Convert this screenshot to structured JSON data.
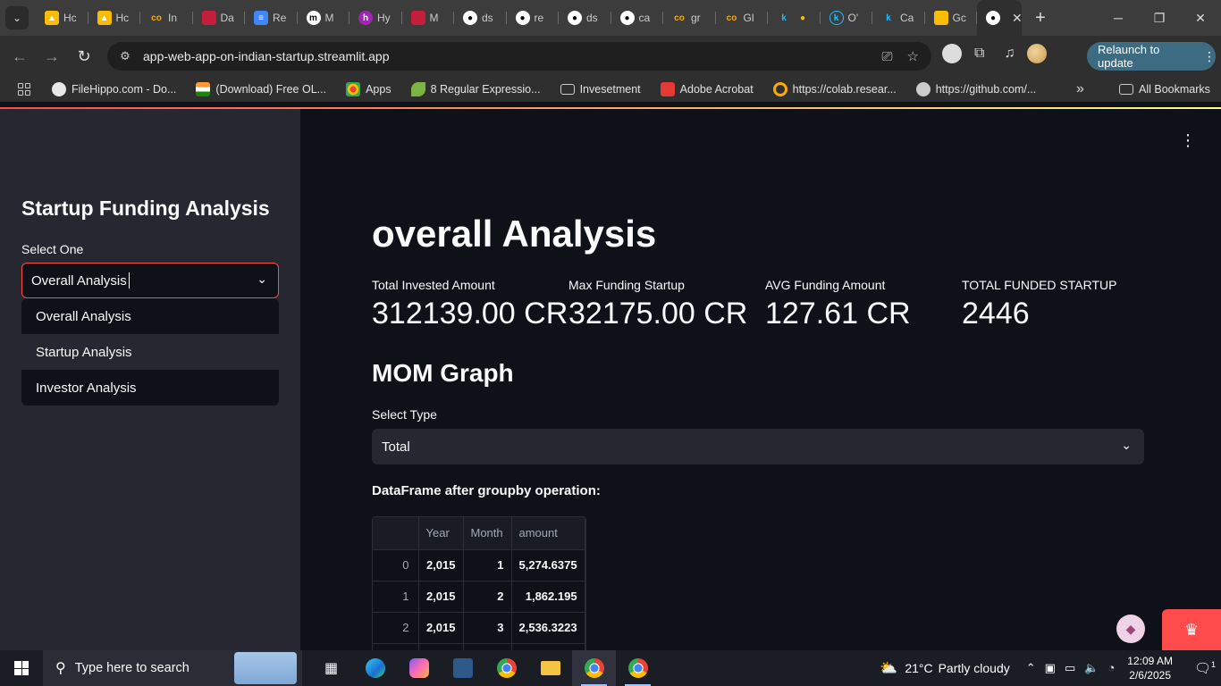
{
  "browser": {
    "tabs": [
      {
        "label": "Hc",
        "icon": "google-drive-icon",
        "color": "#fbbc04"
      },
      {
        "label": "Hc",
        "icon": "google-drive-icon",
        "color": "#fbbc04"
      },
      {
        "label": "In",
        "icon": "colab-icon",
        "color": "#f9ab00"
      },
      {
        "label": "Da",
        "icon": "app-icon",
        "color": "#c41e3a"
      },
      {
        "label": "Re",
        "icon": "docs-icon",
        "color": "#4285f4"
      },
      {
        "label": "M",
        "icon": "medium-icon",
        "color": "#ffffff"
      },
      {
        "label": "Hy",
        "icon": "hashnode-icon",
        "color": "#9c27b0"
      },
      {
        "label": "M",
        "icon": "app-icon",
        "color": "#c41e3a"
      },
      {
        "label": "ds",
        "icon": "github-icon",
        "color": "#ffffff"
      },
      {
        "label": "re",
        "icon": "github-icon",
        "color": "#ffffff"
      },
      {
        "label": "ds",
        "icon": "github-icon",
        "color": "#ffffff"
      },
      {
        "label": "ca",
        "icon": "github-icon",
        "color": "#ffffff"
      },
      {
        "label": "gr",
        "icon": "colab-icon",
        "color": "#f9ab00"
      },
      {
        "label": "Gl",
        "icon": "colab-icon",
        "color": "#f9ab00"
      },
      {
        "label": "",
        "icon": "kaggle-icon",
        "color": "#20beff"
      },
      {
        "label": "O'",
        "icon": "kaggle-circle-icon",
        "color": "#20beff"
      },
      {
        "label": "Ca",
        "icon": "kaggle-icon",
        "color": "#20beff"
      },
      {
        "label": "Gc",
        "icon": "keep-icon",
        "color": "#fbbc04"
      }
    ],
    "url": "app-web-app-on-indian-startup.streamlit.app",
    "relaunch_label": "Relaunch to update",
    "bookmarks": [
      {
        "label": "FileHippo.com - Do...",
        "color": "#e8e8e8"
      },
      {
        "label": "(Download) Free OL...",
        "color": "#ff9933"
      },
      {
        "label": "Apps",
        "color": "#ea4335"
      },
      {
        "label": "8 Regular Expressio...",
        "color": "#7cb342"
      },
      {
        "label": "Invesetment",
        "color": "#cccccc"
      },
      {
        "label": "Adobe Acrobat",
        "color": "#e53935"
      },
      {
        "label": "https://colab.resear...",
        "color": "#f9ab00"
      },
      {
        "label": "https://github.com/...",
        "color": "#cccccc"
      }
    ],
    "all_bookmarks_label": "All Bookmarks"
  },
  "sidebar": {
    "title": "Startup Funding Analysis",
    "select_label": "Select One",
    "selected_value": "Overall Analysis",
    "options": [
      "Overall Analysis",
      "Startup Analysis",
      "Investor Analysis"
    ]
  },
  "main": {
    "title": "overall Analysis",
    "metrics": [
      {
        "label": "Total Invested Amount",
        "value": "312139.00 CR"
      },
      {
        "label": "Max Funding Startup",
        "value": "32175.00 CR"
      },
      {
        "label": "AVG Funding Amount",
        "value": "127.61 CR"
      },
      {
        "label": "TOTAL FUNDED STARTUP",
        "value": "2446"
      }
    ],
    "subheader": "MOM Graph",
    "type_label": "Select Type",
    "type_value": "Total",
    "df_caption": "DataFrame after groupby operation:",
    "table": {
      "columns": [
        "",
        "Year",
        "Month",
        "amount"
      ],
      "rows": [
        [
          "0",
          "2,015",
          "1",
          "5,274.6375"
        ],
        [
          "1",
          "2,015",
          "2",
          "1,862.195"
        ],
        [
          "2",
          "2,015",
          "3",
          "2,536.3223"
        ]
      ]
    }
  },
  "taskbar": {
    "search_placeholder": "Type here to search",
    "weather_temp": "21°C",
    "weather_desc": "Partly cloudy",
    "time": "12:09 AM",
    "date": "2/6/2025",
    "notification_count": "1"
  },
  "colors": {
    "accent": "#ff4b4b",
    "sidebar_bg": "#262730",
    "app_bg": "#0e1117"
  }
}
